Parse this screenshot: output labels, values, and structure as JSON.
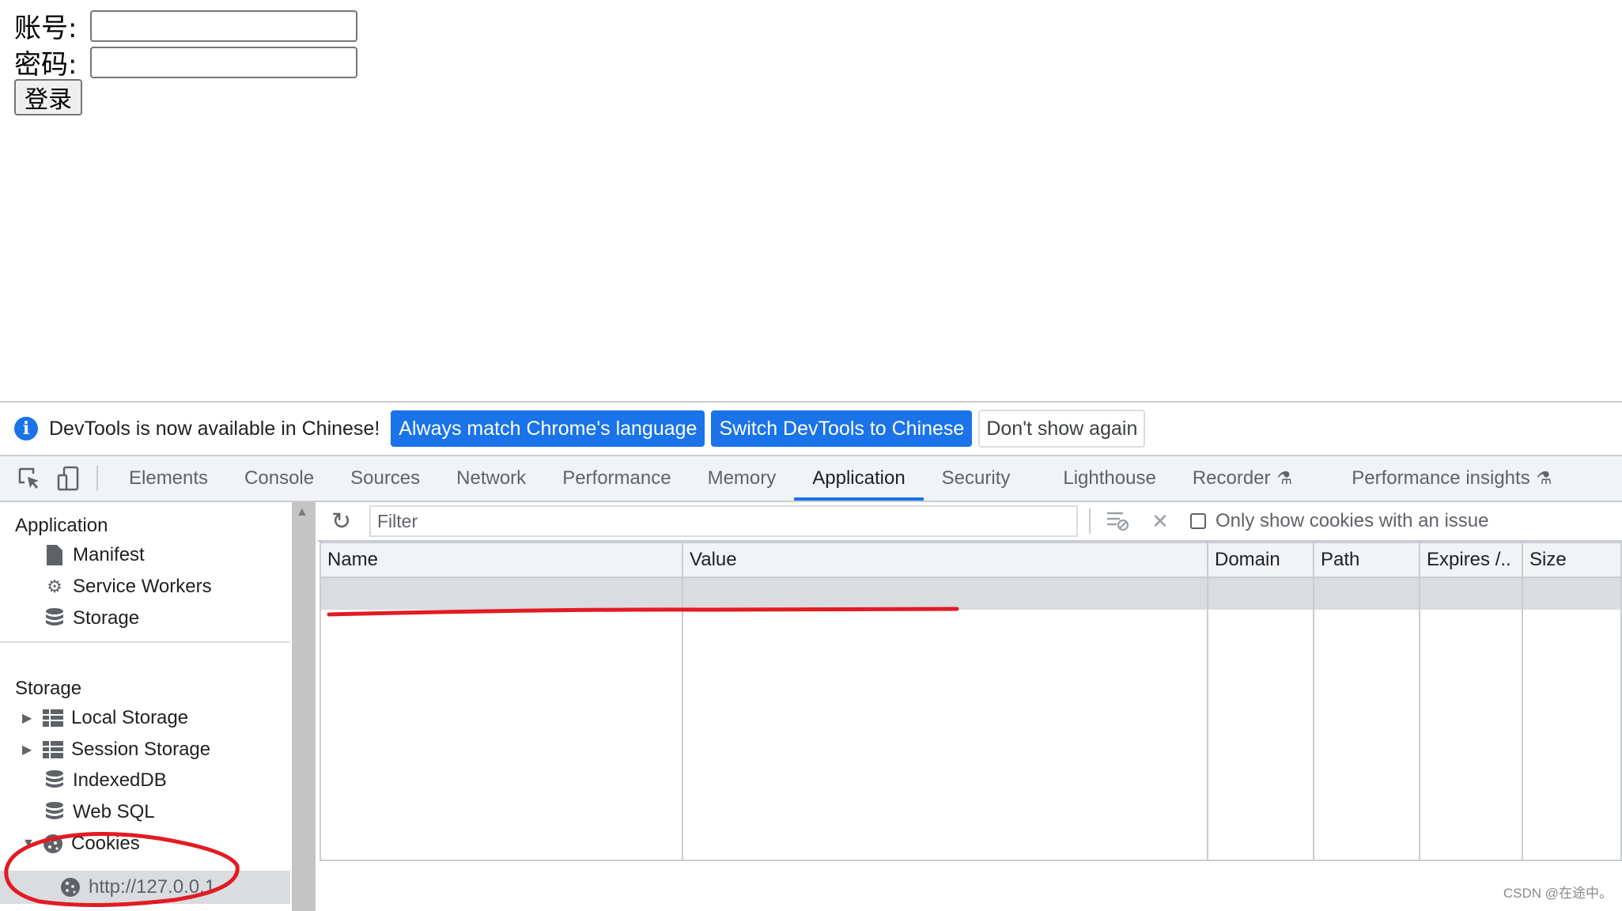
{
  "form": {
    "account_label": "账号:",
    "account_value": "",
    "password_label": "密码:",
    "password_value": "",
    "login_button": "登录"
  },
  "infobar": {
    "message": "DevTools is now available in Chinese!",
    "btn_match": "Always match Chrome's language",
    "btn_switch": "Switch DevTools to Chinese",
    "btn_dismiss": "Don't show again"
  },
  "tabs": {
    "elements": "Elements",
    "console": "Console",
    "sources": "Sources",
    "network": "Network",
    "performance": "Performance",
    "memory": "Memory",
    "application": "Application",
    "security": "Security",
    "lighthouse": "Lighthouse",
    "recorder": "Recorder",
    "performance_insights": "Performance insights"
  },
  "sidebar": {
    "application_header": "Application",
    "app_items": [
      "Manifest",
      "Service Workers",
      "Storage"
    ],
    "storage_header": "Storage",
    "storage_items": [
      "Local Storage",
      "Session Storage",
      "IndexedDB",
      "Web SQL",
      "Cookies"
    ],
    "cookie_origin": "http://127.0.0.1"
  },
  "toolbar": {
    "filter_placeholder": "Filter",
    "only_issues_label": "Only show cookies with an issue"
  },
  "table": {
    "columns": [
      "Name",
      "Value",
      "Domain",
      "Path",
      "Expires /..",
      "Size"
    ]
  },
  "watermark": "CSDN @在途中。",
  "colors": {
    "accent": "#1a73e8",
    "annotation": "#e21b23"
  }
}
